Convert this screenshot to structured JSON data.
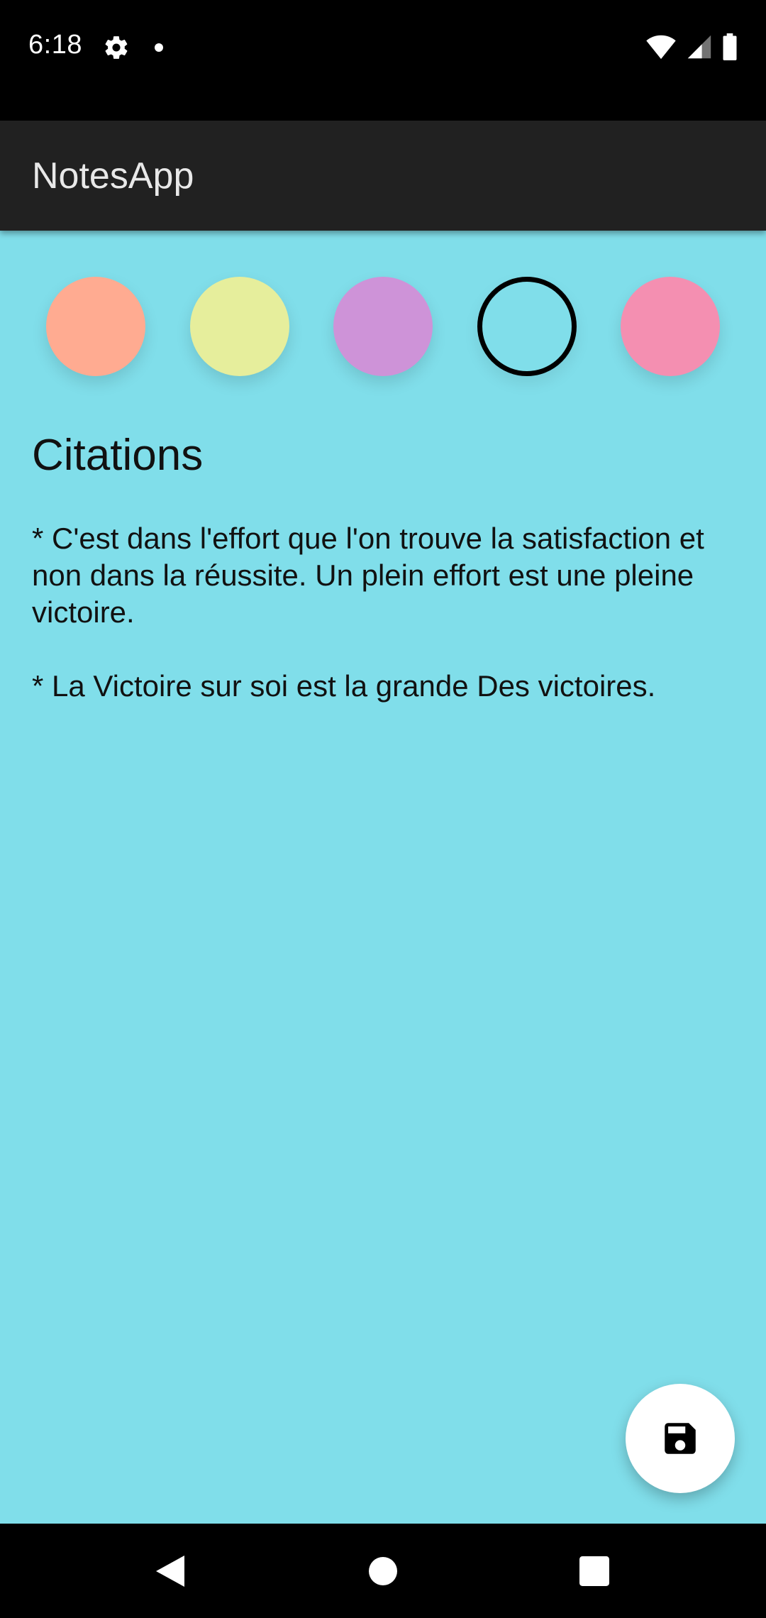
{
  "status_bar": {
    "time": "6:18",
    "icons": [
      "settings-gear-icon",
      "notification-dot-icon",
      "wifi-icon",
      "cellular-signal-icon",
      "battery-icon"
    ]
  },
  "app_bar": {
    "title": "NotesApp"
  },
  "color_picker": {
    "swatches": [
      {
        "name": "orange",
        "color": "#ffab91",
        "selected": false
      },
      {
        "name": "yellow",
        "color": "#e6ee9c",
        "selected": false
      },
      {
        "name": "purple",
        "color": "#ce93d8",
        "selected": false
      },
      {
        "name": "cyan",
        "color": "#80deea",
        "selected": true
      },
      {
        "name": "pink",
        "color": "#f48fb1",
        "selected": false
      }
    ]
  },
  "note": {
    "title": "Citations",
    "paragraphs": [
      "* C'est dans l'effort que l'on trouve la satisfaction et non dans la réussite. Un plein effort est une pleine victoire.",
      "* La Victoire sur soi est la grande Des victoires."
    ],
    "background_color": "#80deea"
  },
  "fab": {
    "icon": "save-icon"
  },
  "nav_bar": {
    "buttons": [
      "back-icon",
      "home-icon",
      "recents-icon"
    ]
  }
}
